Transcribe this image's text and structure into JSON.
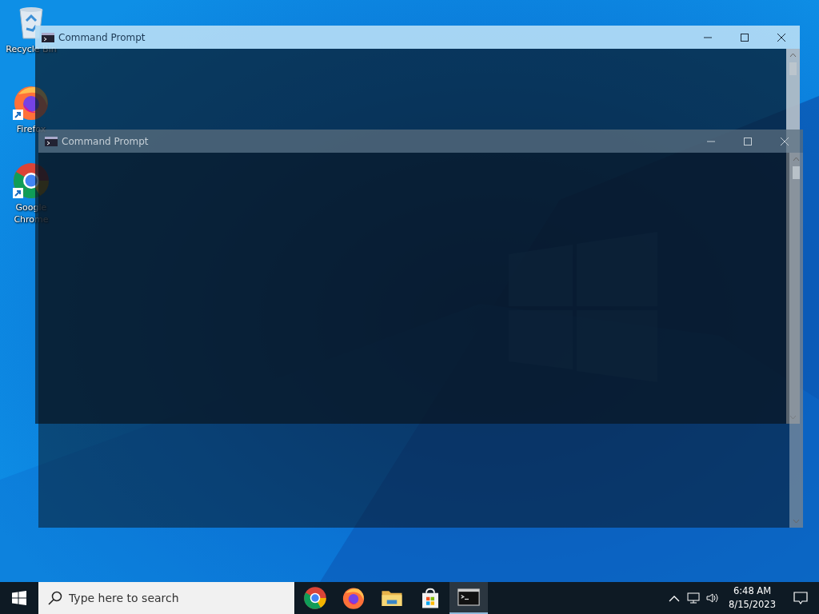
{
  "desktop": {
    "icons": [
      {
        "kind": "recycle",
        "label": "Recycle Bin"
      },
      {
        "kind": "firefox",
        "label": "Firefox"
      },
      {
        "kind": "chrome",
        "label": "Google Chrome"
      }
    ]
  },
  "windows": [
    {
      "title": "Command Prompt",
      "focused": true
    },
    {
      "title": "Command Prompt",
      "focused": false
    }
  ],
  "taskbar": {
    "search": {
      "placeholder": "Type here to search"
    },
    "apps": [
      {
        "kind": "chrome",
        "active": false
      },
      {
        "kind": "firefox",
        "active": false
      },
      {
        "kind": "explorer",
        "active": false
      },
      {
        "kind": "store",
        "active": false
      },
      {
        "kind": "terminal",
        "active": true
      }
    ],
    "clock": {
      "time": "6:48 AM",
      "date": "8/15/2023"
    }
  }
}
